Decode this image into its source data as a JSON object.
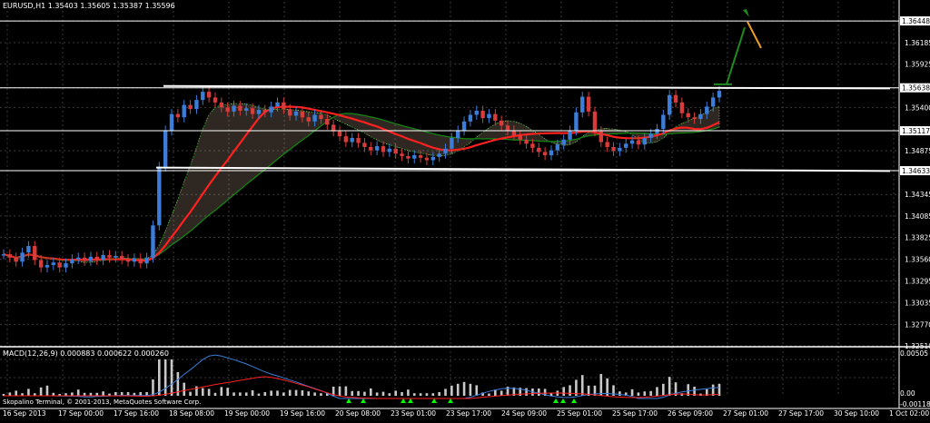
{
  "window": {
    "symbol_header": "EURUSD,H1  1.35403 1.35605 1.35387 1.35596",
    "copyright": "Skopalino Terminal, © 2001-2013, MetaQuotes Software Corp."
  },
  "indicator": {
    "header": "MACD(12,26,9) 0.000883 0.000622 0.000260"
  },
  "colors": {
    "background": "#000000",
    "grid": "#3a3a3a",
    "bull_candle": "#3b7dd8",
    "bear_candle": "#d83b3b",
    "ma_red": "#ff2020",
    "ma_green": "#0f8a0f",
    "cloud": "#d8b89a",
    "level_line": "#ffffff",
    "arrow_green": "#1f8a1f",
    "arrow_orange": "#f0a020",
    "macd_hist": "#c8c8c8",
    "macd_signal_up": "#00ff00"
  },
  "chart_data": {
    "type": "candlestick",
    "symbol": "EURUSD",
    "timeframe": "H1",
    "quote": {
      "open": 1.35403,
      "high": 1.35605,
      "low": 1.35387,
      "close": 1.35596
    },
    "price_axis": {
      "ticks": [
        "1.36448",
        "1.36185",
        "1.35925",
        "1.35638",
        "1.35400",
        "1.35117",
        "1.34875",
        "1.34633",
        "1.34345",
        "1.34085",
        "1.33825",
        "1.33560",
        "1.33295",
        "1.33035",
        "1.32770",
        "1.32510"
      ],
      "highlighted": [
        "1.36448",
        "1.35638",
        "1.35117",
        "1.34633"
      ],
      "range": [
        1.3251,
        1.3668
      ]
    },
    "time_axis": [
      "16 Sep 2013",
      "17 Sep 00:00",
      "17 Sep 16:00",
      "18 Sep 08:00",
      "19 Sep 00:00",
      "19 Sep 16:00",
      "20 Sep 08:00",
      "23 Sep 01:00",
      "23 Sep 17:00",
      "24 Sep 09:00",
      "25 Sep 01:00",
      "25 Sep 17:00",
      "26 Sep 09:00",
      "27 Sep 01:00",
      "27 Sep 17:00",
      "30 Sep 10:00",
      "1 Oct 02:00"
    ],
    "levels": [
      1.36448,
      1.35638,
      1.35117,
      1.34633
    ],
    "close_series": [
      1.3362,
      1.3358,
      1.3353,
      1.3364,
      1.3372,
      1.3355,
      1.3346,
      1.3349,
      1.3352,
      1.3346,
      1.3351,
      1.3356,
      1.3358,
      1.3354,
      1.3359,
      1.3355,
      1.3361,
      1.3358,
      1.336,
      1.3356,
      1.3353,
      1.3357,
      1.3351,
      1.3358,
      1.3397,
      1.3468,
      1.3512,
      1.3532,
      1.3528,
      1.3543,
      1.3538,
      1.3549,
      1.3559,
      1.3552,
      1.3546,
      1.354,
      1.3535,
      1.3542,
      1.3536,
      1.3539,
      1.3532,
      1.3537,
      1.3534,
      1.3541,
      1.3546,
      1.3538,
      1.353,
      1.3535,
      1.3528,
      1.3523,
      1.3531,
      1.3526,
      1.3519,
      1.3511,
      1.3505,
      1.3498,
      1.3503,
      1.3497,
      1.3492,
      1.3488,
      1.3493,
      1.3486,
      1.349,
      1.3484,
      1.3481,
      1.3478,
      1.3482,
      1.3479,
      1.3476,
      1.348,
      1.3484,
      1.349,
      1.3503,
      1.3512,
      1.3523,
      1.3531,
      1.3536,
      1.3527,
      1.3532,
      1.3524,
      1.3518,
      1.3512,
      1.3506,
      1.3501,
      1.3496,
      1.3491,
      1.3486,
      1.3482,
      1.3488,
      1.3495,
      1.3501,
      1.3512,
      1.3534,
      1.3553,
      1.3535,
      1.3511,
      1.3498,
      1.3492,
      1.3487,
      1.3491,
      1.3496,
      1.35,
      1.3495,
      1.3503,
      1.3508,
      1.3514,
      1.3531,
      1.3555,
      1.3546,
      1.3533,
      1.3528,
      1.3526,
      1.3532,
      1.3541,
      1.3552,
      1.356
    ],
    "macd": {
      "fast": 12,
      "slow": 26,
      "signal": 9,
      "macd": 0.000883,
      "signal_value": 0.000622,
      "histogram": 0.00026
    },
    "macd_axis": [
      "0.00505",
      "0.00",
      "-0.00118"
    ]
  }
}
